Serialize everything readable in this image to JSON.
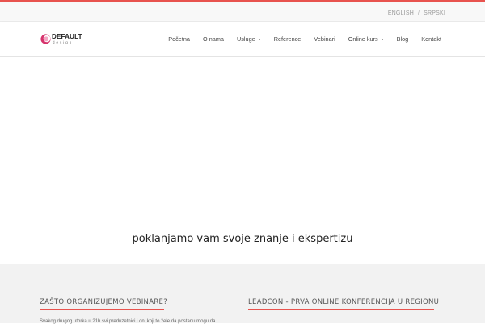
{
  "topbar": {
    "languages": [
      {
        "label": "ENGLISH"
      },
      {
        "label": "SRPSKI"
      }
    ],
    "separator": "/"
  },
  "navbar": {
    "logo": {
      "word": "DEFAULT",
      "sub": "design"
    },
    "menu": [
      {
        "label": "Početna"
      },
      {
        "label": "O nama"
      },
      {
        "label": "Usluge"
      },
      {
        "label": "Reference"
      },
      {
        "label": "Vebinari"
      },
      {
        "label": "Online kurs"
      },
      {
        "label": "Blog"
      },
      {
        "label": "Kontakt"
      }
    ]
  },
  "hero": {
    "tagline": "poklanjamo vam svoje znanje i ekspertizu"
  },
  "features": [
    {
      "title": "ZAŠTO ORGANIZUJEMO VEBINARE?",
      "text": "Svakog drugog utorka u 21h svi preduzetnici i oni koji to žele da postanu mogu da"
    },
    {
      "title": "LEADCON - PRVA ONLINE KONFERENCIJA U REGIONU",
      "text": ""
    }
  ],
  "colors": {
    "accent": "#e8534e",
    "logo_pink": "#d6336c"
  }
}
